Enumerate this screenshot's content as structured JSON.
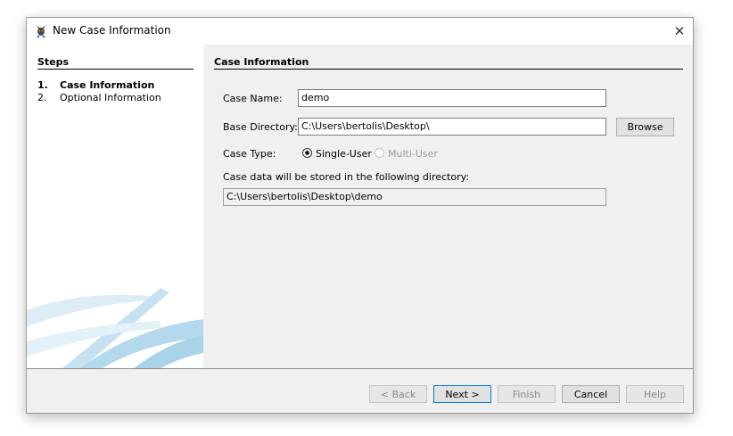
{
  "window": {
    "title": "New Case Information",
    "close_glyph": "✕"
  },
  "steps": {
    "heading": "Steps",
    "items": [
      {
        "num": "1.",
        "label": "Case Information"
      },
      {
        "num": "2.",
        "label": "Optional Information"
      }
    ]
  },
  "panel": {
    "heading": "Case Information",
    "case_name_label": "Case Name:",
    "case_name_value": "demo",
    "base_dir_label": "Base Directory:",
    "base_dir_value": "C:\\Users\\bertolis\\Desktop\\",
    "browse_label": "Browse",
    "case_type_label": "Case Type:",
    "case_type_options": [
      "Single-User",
      "Multi-User"
    ],
    "case_type_selected": "Single-User",
    "storage_note": "Case data will be stored in the following directory:",
    "storage_path": "C:\\Users\\bertolis\\Desktop\\demo"
  },
  "footer": {
    "back_label": "< Back",
    "next_label": "Next >",
    "finish_label": "Finish",
    "cancel_label": "Cancel",
    "help_label": "Help"
  },
  "colors": {
    "accent": "#0078d7",
    "deco_blue": "#a9d3e8"
  },
  "icons": {
    "app": "autopsy-dog-icon",
    "close": "close-icon"
  }
}
